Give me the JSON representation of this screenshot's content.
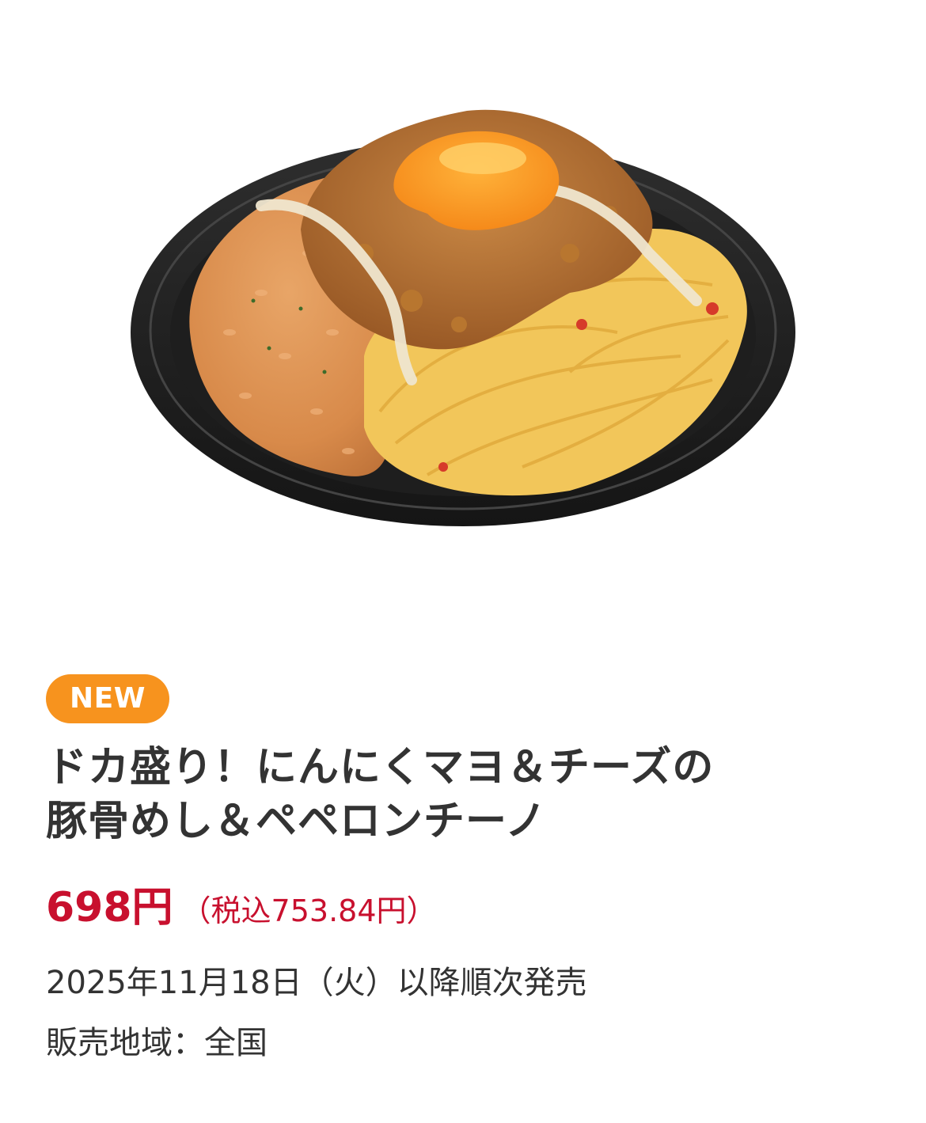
{
  "product": {
    "image_alt": "ドカ盛り！にんにくマヨ＆チーズの豚骨めし＆ペペロンチーノ",
    "badge": "NEW",
    "title_line1": "ドカ盛り！にんにくマヨ＆チーズの",
    "title_line2": "豚骨めし＆ペペロンチーノ",
    "price": "698円",
    "price_with_tax": "（税込753.84円）",
    "release_date": "2025年11月18日（火）以降順次発売",
    "sales_region": "販売地域：全国"
  },
  "colors": {
    "badge_bg": "#f7931e",
    "price": "#c8102e",
    "text": "#333333"
  }
}
